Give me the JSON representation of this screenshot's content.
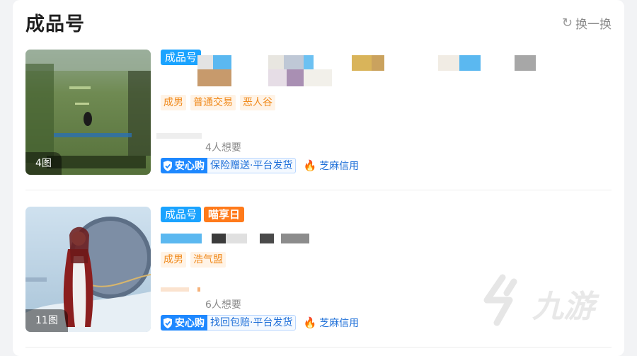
{
  "section": {
    "title": "成品号",
    "refresh_label": "换一换"
  },
  "items": [
    {
      "pic_count": "4图",
      "badges": [
        "成品号"
      ],
      "tags": [
        "成男",
        "普通交易",
        "恶人谷"
      ],
      "wants": "4人想要",
      "shield_label": "安心购",
      "guarantee": "保险赠送·平台发货",
      "sesame": "芝麻信用"
    },
    {
      "pic_count": "11图",
      "badges": [
        "成品号",
        "喵享日"
      ],
      "tags": [
        "成男",
        "浩气盟"
      ],
      "wants": "6人想要",
      "shield_label": "安心购",
      "guarantee": "找回包赔·平台发货",
      "sesame": "芝麻信用"
    }
  ],
  "watermark": "九游",
  "icons": {
    "refresh": "refresh-icon",
    "shield": "shield-check-icon",
    "sesame": "sesame-credit-icon"
  },
  "colors": {
    "accent_blue": "#1aa3ff",
    "guarantee_blue": "#1e88ff",
    "tag_orange": "#f08a1c",
    "badge_orange": "#ff7a1a"
  }
}
